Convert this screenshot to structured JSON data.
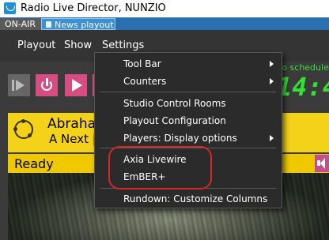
{
  "window": {
    "title": "Radio Live Director, NUNZIO"
  },
  "tabs": [
    {
      "label": "ON-AIR"
    },
    {
      "label": "News playout"
    }
  ],
  "menubar": {
    "items": [
      {
        "label": "Playout"
      },
      {
        "label": "Show"
      },
      {
        "label": "Settings"
      }
    ]
  },
  "settings_menu": {
    "items": [
      {
        "label": "Tool Bar",
        "has_submenu": true
      },
      {
        "label": "Counters",
        "has_submenu": true
      },
      {
        "label": "Studio Control Rooms",
        "has_submenu": false
      },
      {
        "label": "Playout Configuration",
        "has_submenu": false
      },
      {
        "label": "Players: Display options",
        "has_submenu": true
      },
      {
        "label": "Axia Livewire",
        "has_submenu": false,
        "highlighted_by_annotation": true
      },
      {
        "label": "EmBER+",
        "has_submenu": false,
        "highlighted_by_annotation": true
      },
      {
        "label": "Rundown: Customize Columns",
        "has_submenu": false
      }
    ]
  },
  "schedule": {
    "label": "to schedule"
  },
  "clock": {
    "text": "14:4"
  },
  "playout": {
    "item_title": "Abraha",
    "item_subtitle": "A Next |",
    "status": "Ready"
  },
  "colors": {
    "accent_pink": "#d64d84",
    "clock_green": "#35e035",
    "item_yellow": "#f5d21a",
    "annotation_red": "#d9262b",
    "tab_blue": "#3d8fd6"
  },
  "icons": [
    "app-icon",
    "play-next-icon",
    "power-icon",
    "play-icon",
    "mute-icon",
    "submenu-arrow-icon",
    "item-type-icon"
  ]
}
